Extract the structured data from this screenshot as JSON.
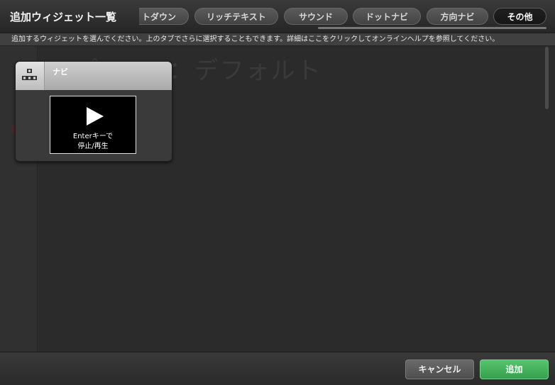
{
  "dialog": {
    "title": "追加ウィジェット一覧",
    "hint": "追加するウィジェットを選んでください。上のタブでさらに選択することもできます。詳細はここをクリックしてオンラインヘルプを参照してください。"
  },
  "background": {
    "ghost_title": "プレ ン ：デフォルト"
  },
  "tabs": [
    {
      "label": "トダウン"
    },
    {
      "label": "リッチテキスト"
    },
    {
      "label": "サウンド"
    },
    {
      "label": "ドットナビ"
    },
    {
      "label": "方向ナビ"
    },
    {
      "label": "その他",
      "active": true
    }
  ],
  "widget_group": {
    "label": "ナビ",
    "icon": "navigation-icon",
    "widget": {
      "icon": "play-icon",
      "line1": "Enterキーで",
      "line2": "停止/再生"
    }
  },
  "footer": {
    "cancel_label": "キャンセル",
    "add_label": "追加"
  },
  "colors": {
    "add_button": "#3fae56",
    "dialog_bg": "#2c2c2c"
  }
}
